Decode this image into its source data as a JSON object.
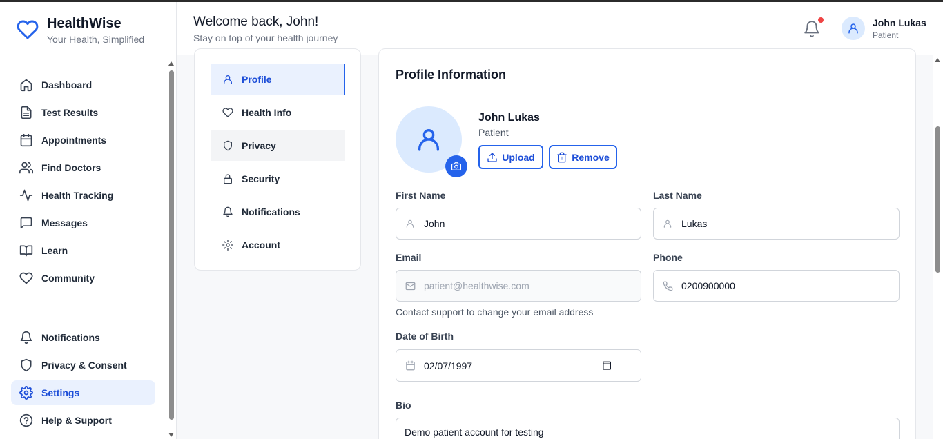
{
  "brand": {
    "title": "HealthWise",
    "subtitle": "Your Health, Simplified"
  },
  "header": {
    "welcome": "Welcome back, John!",
    "subtitle": "Stay on top of your health journey",
    "user_name": "John Lukas",
    "user_role": "Patient",
    "has_unread_notifications": true
  },
  "sidebar": {
    "main_items": [
      {
        "label": "Dashboard",
        "icon": "home-icon"
      },
      {
        "label": "Test Results",
        "icon": "file-text-icon"
      },
      {
        "label": "Appointments",
        "icon": "calendar-icon"
      },
      {
        "label": "Find Doctors",
        "icon": "users-icon"
      },
      {
        "label": "Health Tracking",
        "icon": "activity-icon"
      },
      {
        "label": "Messages",
        "icon": "message-icon"
      },
      {
        "label": "Learn",
        "icon": "book-icon"
      },
      {
        "label": "Community",
        "icon": "heart-icon"
      }
    ],
    "bottom_items": [
      {
        "label": "Notifications",
        "icon": "bell-icon"
      },
      {
        "label": "Privacy & Consent",
        "icon": "shield-icon"
      },
      {
        "label": "Settings",
        "icon": "gear-icon",
        "active": true
      },
      {
        "label": "Help & Support",
        "icon": "help-circle-icon"
      }
    ]
  },
  "settings_tabs": [
    {
      "label": "Profile",
      "icon": "user-icon",
      "active": true
    },
    {
      "label": "Health Info",
      "icon": "heart-icon"
    },
    {
      "label": "Privacy",
      "icon": "shield-icon"
    },
    {
      "label": "Security",
      "icon": "lock-icon"
    },
    {
      "label": "Notifications",
      "icon": "bell-icon"
    },
    {
      "label": "Account",
      "icon": "gear-icon"
    }
  ],
  "profile": {
    "title": "Profile Information",
    "name": "John Lukas",
    "role": "Patient",
    "upload_label": "Upload",
    "remove_label": "Remove",
    "fields": {
      "first_name": {
        "label": "First Name",
        "value": "John"
      },
      "last_name": {
        "label": "Last Name",
        "value": "Lukas"
      },
      "email": {
        "label": "Email",
        "value": "patient@healthwise.com",
        "help": "Contact support to change your email address"
      },
      "phone": {
        "label": "Phone",
        "value": "0200900000"
      },
      "dob": {
        "label": "Date of Birth",
        "value": "02/07/1997"
      },
      "bio": {
        "label": "Bio",
        "value": "Demo patient account for testing"
      }
    }
  },
  "colors": {
    "accent": "#2563eb",
    "active_bg": "#eaf1fe",
    "notification_dot": "#ef4444"
  }
}
